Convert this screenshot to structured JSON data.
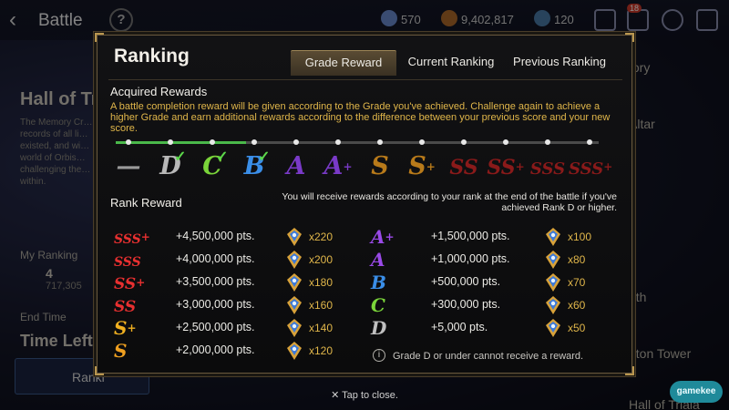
{
  "topbar": {
    "back_label": "Battle",
    "help_label": "?",
    "currency_1": "570",
    "currency_2": "9,402,817",
    "currency_3": "120",
    "notif_count": "18"
  },
  "background": {
    "side_title": "Hall of Tria",
    "side_desc": "The Memory Cr… records of all li… existed, and wi… world of Orbis… challenging the… within.",
    "my_ranking_label": "My Ranking",
    "my_ranking_value": "4",
    "my_ranking_score": "717,305",
    "end_time_label": "End Time",
    "time_left_label": "Time Left:",
    "ranking_button": "Ranki",
    "right_items": [
      "tory",
      "Altar",
      "nth",
      "aton Tower",
      "Hall of Triala"
    ],
    "watermark": "gamekee"
  },
  "modal": {
    "title": "Ranking",
    "tabs": [
      {
        "label": "Grade Reward",
        "active": true
      },
      {
        "label": "Current Ranking",
        "active": false
      },
      {
        "label": "Previous Ranking",
        "active": false
      }
    ],
    "acquired_title": "Acquired Rewards",
    "acquired_desc": "A battle completion reward will be given according to the Grade you've achieved. Challenge again to achieve a higher Grade and earn additional rewards according to the difference between your previous score and your new score.",
    "progress_fraction": 0.27,
    "grades": [
      {
        "label": "—",
        "plus": "",
        "color": "#9a9a9a",
        "checked": false
      },
      {
        "label": "D",
        "plus": "",
        "color": "#b8b8b8",
        "checked": true
      },
      {
        "label": "C",
        "plus": "",
        "color": "#7ad43a",
        "checked": true
      },
      {
        "label": "B",
        "plus": "",
        "color": "#3a8ee8",
        "checked": true
      },
      {
        "label": "A",
        "plus": "",
        "color": "#7a3ac8",
        "checked": false
      },
      {
        "label": "A",
        "plus": "+",
        "color": "#7a3ac8",
        "checked": false
      },
      {
        "label": "S",
        "plus": "",
        "color": "#b87a1a",
        "checked": false
      },
      {
        "label": "S",
        "plus": "+",
        "color": "#b87a1a",
        "checked": false
      },
      {
        "label": "SS",
        "plus": "",
        "color": "#8a1a1a",
        "checked": false
      },
      {
        "label": "SS",
        "plus": "+",
        "color": "#8a1a1a",
        "checked": false
      },
      {
        "label": "SSS",
        "plus": "",
        "color": "#8a1a1a",
        "checked": false
      },
      {
        "label": "SSS",
        "plus": "+",
        "color": "#8a1a1a",
        "checked": false
      }
    ],
    "rank_reward_title": "Rank Reward",
    "rank_note": "You will receive rewards according to your rank at the end of the battle if you've achieved Rank D or higher.",
    "rewards_left": [
      {
        "grade": "SSS",
        "plus": "+",
        "color": "#e83030",
        "pts": "+4,500,000 pts.",
        "qty": "x220"
      },
      {
        "grade": "SSS",
        "plus": "",
        "color": "#e83030",
        "pts": "+4,000,000 pts.",
        "qty": "x200"
      },
      {
        "grade": "SS",
        "plus": "+",
        "color": "#e83030",
        "pts": "+3,500,000 pts.",
        "qty": "x180"
      },
      {
        "grade": "SS",
        "plus": "",
        "color": "#e83030",
        "pts": "+3,000,000 pts.",
        "qty": "x160"
      },
      {
        "grade": "S",
        "plus": "+",
        "color": "#f0b020",
        "pts": "+2,500,000 pts.",
        "qty": "x140"
      },
      {
        "grade": "S",
        "plus": "",
        "color": "#f0a020",
        "pts": "+2,000,000 pts.",
        "qty": "x120"
      }
    ],
    "rewards_right": [
      {
        "grade": "A",
        "plus": "+",
        "color": "#9a4ae8",
        "pts": "+1,500,000 pts.",
        "qty": "x100"
      },
      {
        "grade": "A",
        "plus": "",
        "color": "#9a4ae8",
        "pts": "+1,000,000 pts.",
        "qty": "x80"
      },
      {
        "grade": "B",
        "plus": "",
        "color": "#3a8ee8",
        "pts": "+500,000 pts.",
        "qty": "x70"
      },
      {
        "grade": "C",
        "plus": "",
        "color": "#7ad43a",
        "pts": "+300,000 pts.",
        "qty": "x60"
      },
      {
        "grade": "D",
        "plus": "",
        "color": "#c0c0c0",
        "pts": "+5,000 pts.",
        "qty": "x50"
      }
    ],
    "info_icon": "i",
    "info_text": "Grade D or under cannot receive a reward."
  },
  "footer": {
    "close_hint": "✕ Tap to close."
  }
}
